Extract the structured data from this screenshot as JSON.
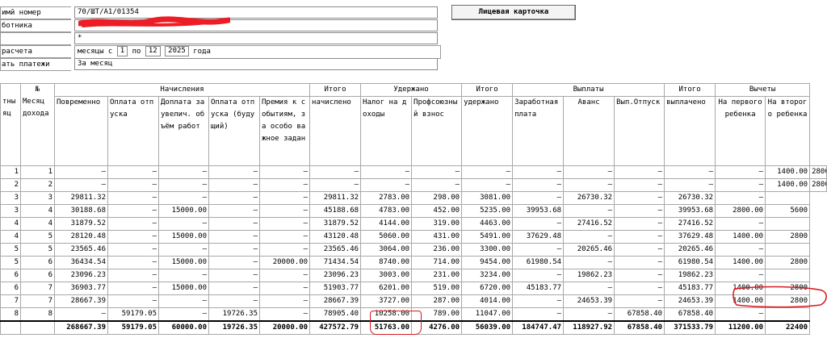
{
  "form": {
    "tab_number_label": "имй номер",
    "tab_number_value": "70/ШТ/А1/01354",
    "employee_label": "ботника",
    "employee_value": "",
    "field3_value": "*",
    "calc_label": " расчета",
    "period_label": "месяцы  с",
    "period_from": "1",
    "period_to_label": "по",
    "period_to": "12",
    "year": "2025",
    "year_suffix": "года",
    "payments_label": "ать платежи",
    "payments_value": "За месяц"
  },
  "toolbar": {
    "card_button": "Лицевая карточка"
  },
  "table": {
    "headers": {
      "col_a": "тны\nяц",
      "col_num_top": "№",
      "col_month": "Месяц дохода",
      "group_accruals": "Начисления",
      "accr": [
        "Повременно",
        "Оплата отпуска",
        "Доплата за увелич. объём работ",
        "Оплата отпуска (будущий)",
        "Премия к событиям, за особо важное задан"
      ],
      "total_accrued_top": "Итого",
      "total_accrued": "начислено",
      "group_withheld": "Удержано",
      "with": [
        "Налог на доходы",
        "Профсоюзный взнос"
      ],
      "total_withheld_top": "Итого",
      "total_withheld": "удержано",
      "group_payments": "Выплаты",
      "pay": [
        "Заработная плата",
        "Аванс",
        "Вып.Отпуск"
      ],
      "total_paid_top": "Итого",
      "total_paid": "выплачено",
      "group_deductions": "Вычеты",
      "ded": [
        "На первого ребенка",
        "На второго ребенка"
      ]
    },
    "rows": [
      [
        "1",
        "1",
        "–",
        "–",
        "–",
        "–",
        "–",
        "–",
        "–",
        "–",
        "–",
        "–",
        "–",
        "–",
        "–",
        "–",
        "1400.00",
        "2800"
      ],
      [
        "2",
        "2",
        "–",
        "–",
        "–",
        "–",
        "–",
        "–",
        "–",
        "–",
        "–",
        "–",
        "–",
        "–",
        "–",
        "–",
        "1400.00",
        "2800"
      ],
      [
        "3",
        "3",
        "29811.32",
        "–",
        "–",
        "–",
        "–",
        "29811.32",
        "2783.00",
        "298.00",
        "3081.00",
        "–",
        "26730.32",
        "–",
        "26730.32",
        "–",
        ""
      ],
      [
        "3",
        "4",
        "30188.68",
        "–",
        "15000.00",
        "–",
        "–",
        "45188.68",
        "4783.00",
        "452.00",
        "5235.00",
        "39953.68",
        "–",
        "–",
        "39953.68",
        "2800.00",
        "5600"
      ],
      [
        "4",
        "4",
        "31879.52",
        "–",
        "–",
        "–",
        "–",
        "31879.52",
        "4144.00",
        "319.00",
        "4463.00",
        "–",
        "27416.52",
        "–",
        "27416.52",
        "–",
        ""
      ],
      [
        "4",
        "5",
        "28120.48",
        "–",
        "15000.00",
        "–",
        "–",
        "43120.48",
        "5060.00",
        "431.00",
        "5491.00",
        "37629.48",
        "–",
        "–",
        "37629.48",
        "1400.00",
        "2800"
      ],
      [
        "5",
        "5",
        "23565.46",
        "–",
        "–",
        "–",
        "–",
        "23565.46",
        "3064.00",
        "236.00",
        "3300.00",
        "–",
        "20265.46",
        "–",
        "20265.46",
        "–",
        ""
      ],
      [
        "5",
        "6",
        "36434.54",
        "–",
        "15000.00",
        "–",
        "20000.00",
        "71434.54",
        "8740.00",
        "714.00",
        "9454.00",
        "61980.54",
        "–",
        "–",
        "61980.54",
        "1400.00",
        "2800"
      ],
      [
        "6",
        "6",
        "23096.23",
        "–",
        "–",
        "–",
        "–",
        "23096.23",
        "3003.00",
        "231.00",
        "3234.00",
        "–",
        "19862.23",
        "–",
        "19862.23",
        "–",
        ""
      ],
      [
        "6",
        "7",
        "36903.77",
        "–",
        "15000.00",
        "–",
        "–",
        "51903.77",
        "6201.00",
        "519.00",
        "6720.00",
        "45183.77",
        "–",
        "–",
        "45183.77",
        "1400.00",
        "2800"
      ],
      [
        "7",
        "7",
        "28667.39",
        "–",
        "–",
        "–",
        "–",
        "28667.39",
        "3727.00",
        "287.00",
        "4014.00",
        "–",
        "24653.39",
        "–",
        "24653.39",
        "1400.00",
        "2800"
      ],
      [
        "8",
        "8",
        "–",
        "59179.05",
        "–",
        "19726.35",
        "–",
        "78905.40",
        "10258.00",
        "789.00",
        "11047.00",
        "–",
        "–",
        "67858.40",
        "67858.40",
        "–",
        ""
      ]
    ],
    "totals": [
      "",
      "",
      "268667.39",
      "59179.05",
      "60000.00",
      "19726.35",
      "20000.00",
      "427572.79",
      "51763.00",
      "4276.00",
      "56039.00",
      "184747.47",
      "118927.92",
      "67858.40",
      "371533.79",
      "11200.00",
      "22400"
    ]
  },
  "colors": {
    "annotation_red": "#d6181e",
    "redaction_red": "#ee1c25"
  }
}
